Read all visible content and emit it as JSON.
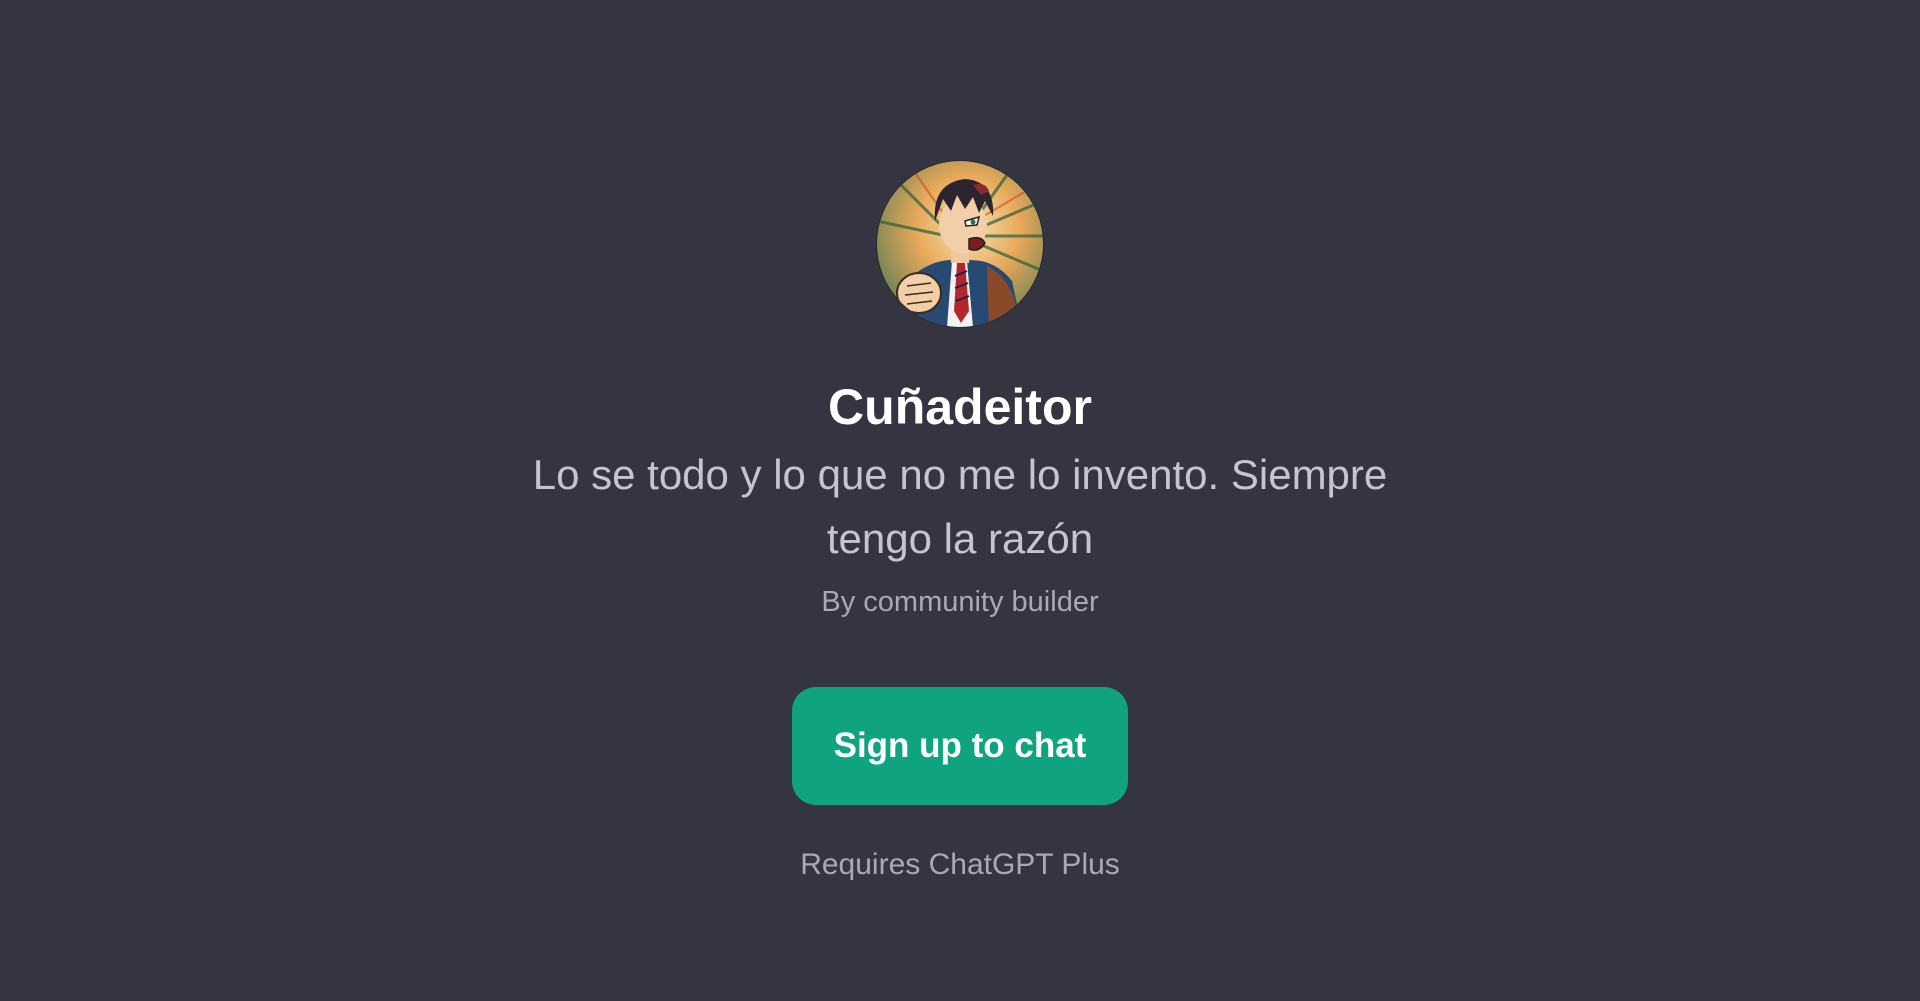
{
  "gpt": {
    "name": "Cuñadeitor",
    "description": "Lo se todo y lo que no me lo invento. Siempre tengo la razón",
    "byline": "By community builder",
    "avatar_icon": "anime-man-shouting-avatar"
  },
  "cta": {
    "label": "Sign up to chat"
  },
  "footer": {
    "requires": "Requires ChatGPT Plus"
  },
  "colors": {
    "background": "#343541",
    "button": "#10a37f",
    "title": "#ffffff",
    "description": "#c5c5d2",
    "muted": "#a9a9b3"
  }
}
